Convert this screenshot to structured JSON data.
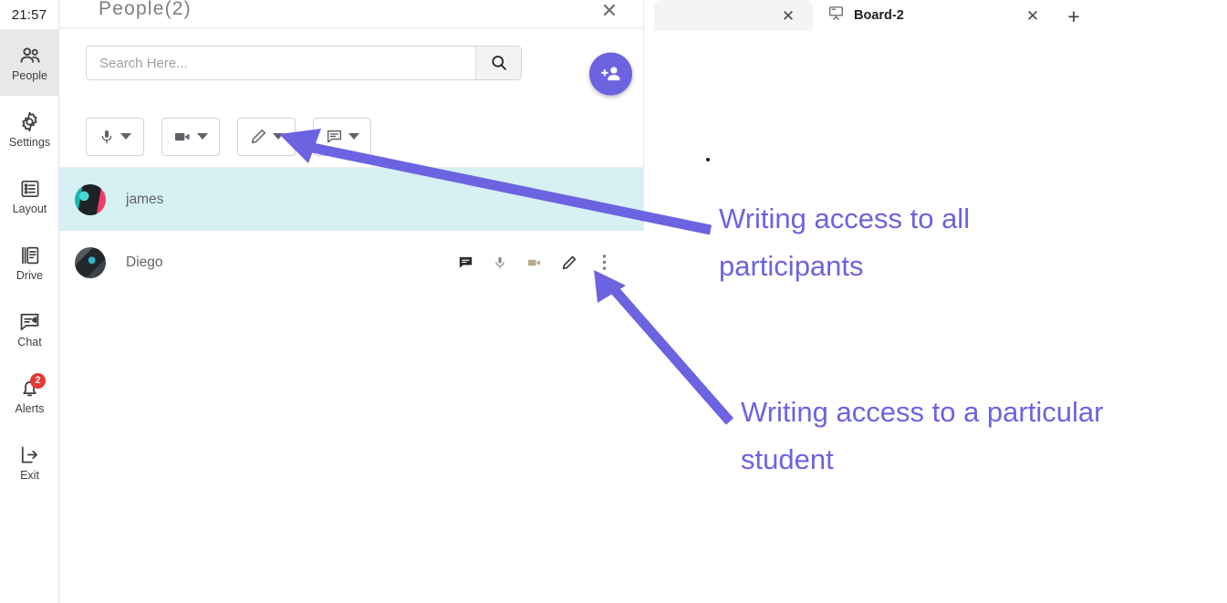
{
  "colors": {
    "accent_purple": "#6c63e0",
    "selected_row": "#d6f0f3",
    "badge_red": "#e53935",
    "rail_active": "#e8e8e8"
  },
  "rail": {
    "clock": "21:57",
    "items": [
      {
        "label": "People",
        "icon": "people-icon",
        "active": true,
        "badge": null
      },
      {
        "label": "Settings",
        "icon": "gear-icon",
        "active": false,
        "badge": null
      },
      {
        "label": "Layout",
        "icon": "layout-icon",
        "active": false,
        "badge": null
      },
      {
        "label": "Drive",
        "icon": "drive-icon",
        "active": false,
        "badge": null
      },
      {
        "label": "Chat",
        "icon": "chat-icon",
        "active": false,
        "badge": null
      },
      {
        "label": "Alerts",
        "icon": "bell-icon",
        "active": false,
        "badge": "2"
      },
      {
        "label": "Exit",
        "icon": "exit-icon",
        "active": false,
        "badge": null
      }
    ]
  },
  "panel": {
    "title": "People(2)",
    "close_icon": "close-icon",
    "search": {
      "placeholder": "Search Here...",
      "value": "",
      "button_icon": "search-icon"
    },
    "add_person": {
      "icon": "add-person-icon",
      "tooltip": "Add person"
    },
    "controls": [
      {
        "name": "mic-control",
        "icon": "microphone-icon",
        "caret": "chevron-down-icon"
      },
      {
        "name": "video-control",
        "icon": "video-camera-icon",
        "caret": "chevron-down-icon"
      },
      {
        "name": "pencil-control",
        "icon": "pencil-icon",
        "caret": "chevron-down-icon"
      },
      {
        "name": "chat-control",
        "icon": "chat-bubble-icon",
        "caret": "chevron-down-icon"
      }
    ],
    "participants": [
      {
        "name": "james",
        "avatar": "a-james",
        "selected": true,
        "actions": []
      },
      {
        "name": "Diego",
        "avatar": "a-diego",
        "selected": false,
        "actions": [
          {
            "name": "chat-icon",
            "state": "active"
          },
          {
            "name": "microphone-icon",
            "state": "muted"
          },
          {
            "name": "video-camera-icon",
            "state": "off"
          },
          {
            "name": "pencil-icon",
            "state": "active"
          },
          {
            "name": "more-vertical-icon",
            "state": "default"
          }
        ]
      }
    ]
  },
  "browser": {
    "tabs": [
      {
        "title": "",
        "icon": null,
        "active": false,
        "close_icon": "close-icon"
      },
      {
        "title": "Board-2",
        "icon": "whiteboard-icon",
        "active": true,
        "close_icon": "close-icon"
      }
    ],
    "new_tab_label": "+"
  },
  "annotations": [
    {
      "text": "Writing access to all\nparticipants",
      "color": "#6c63e0",
      "arrow": "arrow-to-pencil-control"
    },
    {
      "text": "Writing access to a particular\nstudent",
      "color": "#6c63e0",
      "arrow": "arrow-to-row-pencil"
    }
  ]
}
